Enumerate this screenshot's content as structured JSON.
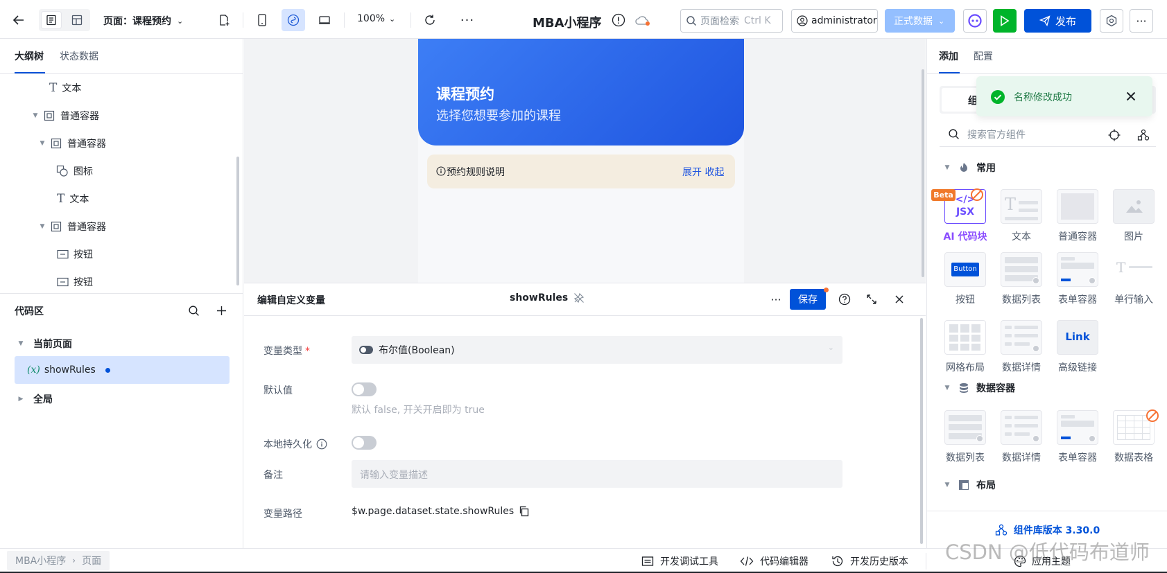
{
  "topbar": {
    "page_label": "页面：课程预约",
    "zoom": "100%",
    "app_title": "MBA小程序",
    "search_placeholder": "页面检索",
    "search_shortcut": "Ctrl K",
    "user": "administrator",
    "data_env": "正式数据",
    "publish": "发布"
  },
  "left": {
    "tabs": [
      "大纲树",
      "状态数据"
    ],
    "tree": [
      {
        "label": "文本",
        "icon": "text-icon"
      },
      {
        "label": "普通容器",
        "icon": "container-icon"
      },
      {
        "label": "普通容器",
        "icon": "container-icon"
      },
      {
        "label": "图标",
        "icon": "icon-component-icon"
      },
      {
        "label": "文本",
        "icon": "text-icon"
      },
      {
        "label": "普通容器",
        "icon": "container-icon"
      },
      {
        "label": "按钮",
        "icon": "button-component-icon"
      },
      {
        "label": "按钮",
        "icon": "button-component-icon"
      }
    ],
    "code_title": "代码区",
    "current_page": "当前页面",
    "variable": "showRules",
    "variable_prefix": "(x)",
    "global": "全局"
  },
  "canvas": {
    "header_title": "课程预约",
    "header_subtitle": "选择您想要参加的课程",
    "rules_label": "预约规则说明",
    "expand_label": "展开 收起",
    "accent": "#2f6ef7"
  },
  "editor": {
    "title": "编辑自定义变量",
    "var_name": "showRules",
    "save": "保存",
    "type_label": "变量类型",
    "type_value": "布尔值(Boolean)",
    "default_label": "默认值",
    "default_hint": "默认 false, 开关开启即为 true",
    "persist_label": "本地持久化",
    "note_label": "备注",
    "note_placeholder": "请输入变量描述",
    "path_label": "变量路径",
    "path_value": "$w.page.dataset.state.showRules"
  },
  "right": {
    "tabs": [
      "添加",
      "配置"
    ],
    "toast": "名称修改成功",
    "search_placeholder": "搜索官方组件",
    "section_common": "常用",
    "section_data": "数据容器",
    "section_layout": "布局",
    "common_items": [
      "AI 代码块",
      "文本",
      "普通容器",
      "图片",
      "按钮",
      "数据列表",
      "表单容器",
      "单行输入",
      "网格布局",
      "数据详情",
      "高级链接"
    ],
    "data_items": [
      "数据列表",
      "数据详情",
      "表单容器",
      "数据表格"
    ],
    "beta": "Beta",
    "jsx": "JSX",
    "button_text": "Button",
    "link_text": "Link",
    "version": "组件库版本 3.30.0",
    "theme": "应用主题",
    "tab_partial": "组"
  },
  "bottom": {
    "breadcrumb": [
      "MBA小程序",
      "页面"
    ],
    "debug": "开发调试工具",
    "code_editor": "代码编辑器",
    "history": "开发历史版本"
  },
  "watermark": "CSDN @低代码布道师"
}
